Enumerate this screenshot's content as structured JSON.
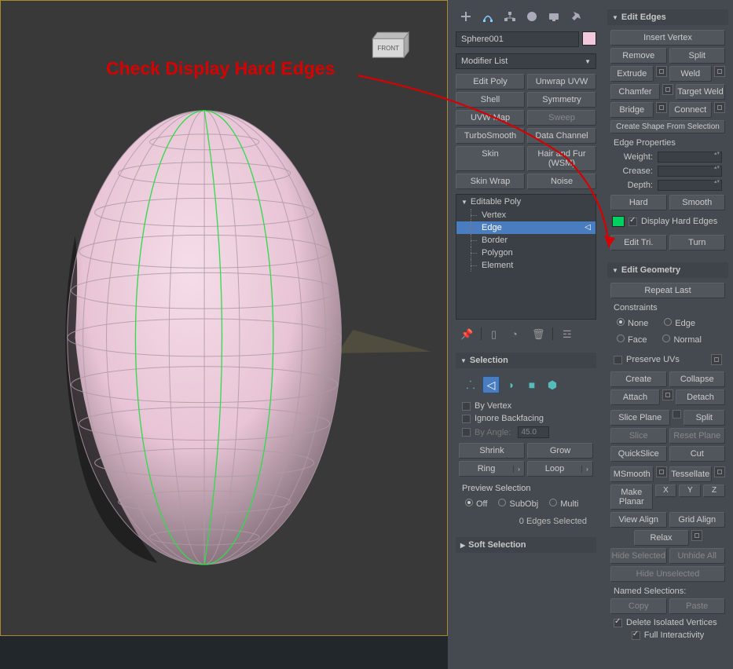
{
  "annotation": "Check Display Hard Edges",
  "viewport": {
    "cube_label": "FRONT"
  },
  "object_name": "Sphere001",
  "modifier_list_label": "Modifier List",
  "modifier_buttons": [
    "Edit Poly",
    "Unwrap UVW",
    "Shell",
    "Symmetry",
    "UVW Map",
    "Sweep",
    "TurboSmooth",
    "Data Channel",
    "Skin",
    "Hair and Fur (WSM)",
    "Skin Wrap",
    "Noise"
  ],
  "stack": {
    "top": "Editable Poly",
    "subs": [
      "Vertex",
      "Edge",
      "Border",
      "Polygon",
      "Element"
    ],
    "selected": "Edge"
  },
  "selection": {
    "header": "Selection",
    "by_vertex": "By Vertex",
    "ignore_backfacing": "Ignore Backfacing",
    "by_angle": "By Angle:",
    "angle_value": "45.0",
    "shrink": "Shrink",
    "grow": "Grow",
    "ring": "Ring",
    "loop": "Loop",
    "preview_label": "Preview Selection",
    "off": "Off",
    "subobj": "SubObj",
    "multi": "Multi",
    "status": "0 Edges Selected"
  },
  "soft_selection_header": "Soft Selection",
  "edit_edges": {
    "header": "Edit Edges",
    "insert_vertex": "Insert Vertex",
    "remove": "Remove",
    "split": "Split",
    "extrude": "Extrude",
    "weld": "Weld",
    "chamfer": "Chamfer",
    "target_weld": "Target Weld",
    "bridge": "Bridge",
    "connect": "Connect",
    "create_shape": "Create Shape From Selection",
    "edge_props": "Edge Properties",
    "weight": "Weight:",
    "crease": "Crease:",
    "depth": "Depth:",
    "hard": "Hard",
    "smooth": "Smooth",
    "display_hard_edges": "Display Hard Edges",
    "edit_tri": "Edit Tri.",
    "turn": "Turn"
  },
  "edit_geometry": {
    "header": "Edit Geometry",
    "repeat_last": "Repeat Last",
    "constraints": "Constraints",
    "none": "None",
    "edge": "Edge",
    "face": "Face",
    "normal": "Normal",
    "preserve_uvs": "Preserve UVs",
    "create": "Create",
    "collapse": "Collapse",
    "attach": "Attach",
    "detach": "Detach",
    "slice_plane": "Slice Plane",
    "split_btn": "Split",
    "slice": "Slice",
    "reset_plane": "Reset Plane",
    "quickslice": "QuickSlice",
    "cut": "Cut",
    "msmooth": "MSmooth",
    "tessellate": "Tessellate",
    "make_planar": "Make Planar",
    "x": "X",
    "y": "Y",
    "z": "Z",
    "view_align": "View Align",
    "grid_align": "Grid Align",
    "relax": "Relax",
    "hide_selected": "Hide Selected",
    "unhide_all": "Unhide All",
    "hide_unselected": "Hide Unselected",
    "named_selections": "Named Selections:",
    "copy": "Copy",
    "paste": "Paste",
    "delete_isolated": "Delete Isolated Vertices",
    "full_interactivity": "Full Interactivity"
  }
}
